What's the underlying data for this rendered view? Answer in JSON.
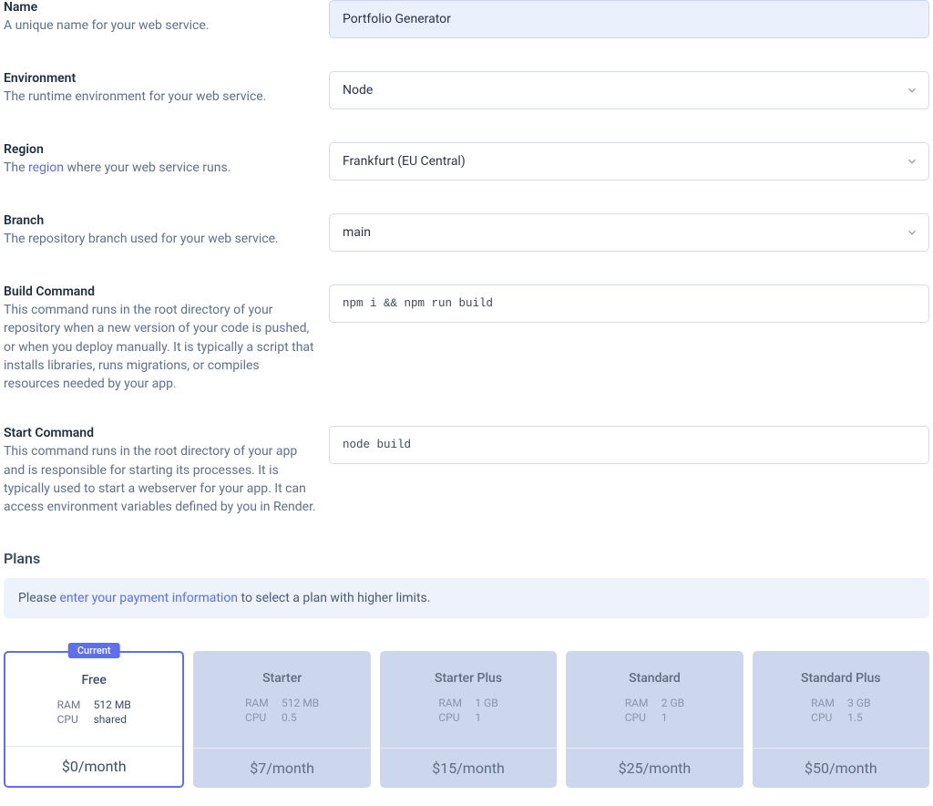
{
  "fields": {
    "name": {
      "label": "Name",
      "desc": "A unique name for your web service.",
      "value": "Portfolio Generator"
    },
    "environment": {
      "label": "Environment",
      "desc": "The runtime environment for your web service.",
      "value": "Node"
    },
    "region": {
      "label": "Region",
      "desc_pre": "The ",
      "desc_link": "region",
      "desc_post": " where your web service runs.",
      "value": "Frankfurt (EU Central)"
    },
    "branch": {
      "label": "Branch",
      "desc": "The repository branch used for your web service.",
      "value": "main"
    },
    "build": {
      "label": "Build Command",
      "desc": "This command runs in the root directory of your repository when a new version of your code is pushed, or when you deploy manually. It is typically a script that installs libraries, runs migrations, or compiles resources needed by your app.",
      "value": "npm i && npm run build"
    },
    "start": {
      "label": "Start Command",
      "desc": "This command runs in the root directory of your app and is responsible for starting its processes. It is typically used to start a webserver for your app. It can access environment variables defined by you in Render.",
      "value": "node build"
    }
  },
  "plans_section": {
    "title": "Plans",
    "notice_pre": "Please ",
    "notice_link": "enter your payment information",
    "notice_post": " to select a plan with higher limits.",
    "current_badge": "Current",
    "spec_labels": {
      "ram": "RAM",
      "cpu": "CPU"
    }
  },
  "plans": [
    {
      "name": "Free",
      "ram": "512 MB",
      "cpu": "shared",
      "price": "$0/month",
      "current": true
    },
    {
      "name": "Starter",
      "ram": "512 MB",
      "cpu": "0.5",
      "price": "$7/month",
      "current": false
    },
    {
      "name": "Starter Plus",
      "ram": "1 GB",
      "cpu": "1",
      "price": "$15/month",
      "current": false
    },
    {
      "name": "Standard",
      "ram": "2 GB",
      "cpu": "1",
      "price": "$25/month",
      "current": false
    },
    {
      "name": "Standard Plus",
      "ram": "3 GB",
      "cpu": "1.5",
      "price": "$50/month",
      "current": false
    }
  ]
}
